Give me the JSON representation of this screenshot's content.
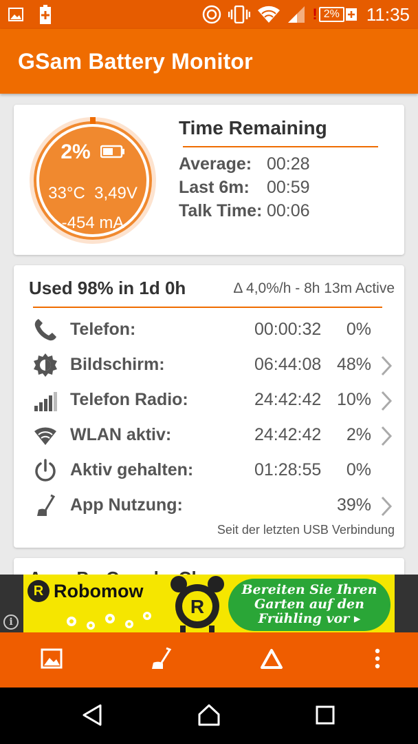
{
  "status_bar": {
    "time": "11:35",
    "battery_percent": "2%",
    "icons": [
      "image-icon",
      "battery-plus-icon",
      "gsam-icon",
      "vibrate-icon",
      "wifi-icon",
      "signal-icon",
      "battery-alert-icon"
    ]
  },
  "app_bar": {
    "title": "GSam Battery Monitor"
  },
  "battery_gauge": {
    "percent": "2%",
    "temperature": "33°C",
    "voltage": "3,49V",
    "current": "-454 mA",
    "level_fraction": 0.02,
    "color": "#f0892f"
  },
  "time_remaining": {
    "title": "Time Remaining",
    "rows": [
      {
        "label": "Average:",
        "value": "00:28"
      },
      {
        "label": "Last 6m:",
        "value": "00:59"
      },
      {
        "label": "Talk Time:",
        "value": "00:06"
      }
    ]
  },
  "usage": {
    "title": "Used 98% in 1d 0h",
    "rate": "Δ 4,0%/h - 8h 13m Active",
    "rows": [
      {
        "icon": "phone-icon",
        "label": "Telefon:",
        "time": "00:00:32",
        "percent": "0%",
        "has_chevron": false
      },
      {
        "icon": "brightness-icon",
        "label": "Bildschirm:",
        "time": "06:44:08",
        "percent": "48%",
        "has_chevron": true
      },
      {
        "icon": "signal-bars-icon",
        "label": "Telefon Radio:",
        "time": "24:42:42",
        "percent": "10%",
        "has_chevron": true
      },
      {
        "icon": "wifi-icon",
        "label": "WLAN aktiv:",
        "time": "24:42:42",
        "percent": "2%",
        "has_chevron": true
      },
      {
        "icon": "power-icon",
        "label": "Aktiv gehalten:",
        "time": "01:28:55",
        "percent": "0%",
        "has_chevron": false
      },
      {
        "icon": "app-usage-icon",
        "label": "App Nutzung:",
        "time": "",
        "percent": "39%",
        "has_chevron": true
      }
    ],
    "footer": "Seit der letzten USB Verbindung"
  },
  "third_card": {
    "partial_title": "A... ...P... C... ...l... Ch..."
  },
  "ad": {
    "brand": "Robomow",
    "logo_letter": "R",
    "cta_line1": "Bereiten Sie Ihren",
    "cta_line2": "Garten auf den",
    "cta_line3": "Frühling vor ▸",
    "info_glyph": "i"
  },
  "action_bar": {
    "buttons": [
      "image-icon",
      "app-usage-icon",
      "delta-icon",
      "more-vert-icon"
    ]
  },
  "nav_bar": {
    "buttons": [
      "back-icon",
      "home-icon",
      "recents-icon"
    ]
  },
  "colors": {
    "accent": "#ef6c00",
    "status_bar": "#e65c00",
    "gauge": "#f0892f"
  }
}
